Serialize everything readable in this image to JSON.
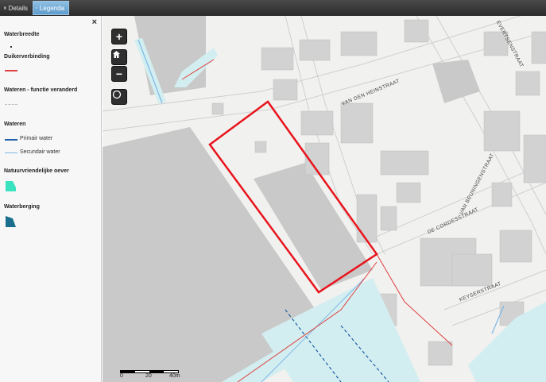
{
  "tabs": {
    "details": "Details",
    "legend": "Legenda"
  },
  "legend": {
    "close": "×",
    "waterbreedte": "Waterbreedte",
    "duiker": "Duikerverbinding",
    "wateren_functie": "Wateren - functie veranderd",
    "wateren": "Wateren",
    "primair": "Primair water",
    "secundair": "Secundair water",
    "natuurvriendelijk": "Natuurvriendelijke oever",
    "waterberging": "Waterberging"
  },
  "map_controls": {
    "zoom_in": "+",
    "home": "⌂",
    "zoom_out": "−"
  },
  "scale": {
    "labels": [
      "0",
      "20",
      "40m"
    ]
  },
  "streets": {
    "van_den_heinstraat": "VAN DEN HEINSTRAAT",
    "van_beuningenstraat": "VAN BEUNINGENSTRAAT",
    "de_cordesstraat": "DE CORDESSTRAAT",
    "keyserstraat": "KEYSERSTRAAT",
    "evertsenstraat": "EVERTSENSTRAAT"
  },
  "colors": {
    "primair": "#1f5fa8",
    "secundair": "#7db8e6",
    "duiker": "#e04040",
    "natuurvriendelijk": "#39e3c0",
    "waterberging": "#1a6f8f",
    "highlight": "#e8141c"
  }
}
